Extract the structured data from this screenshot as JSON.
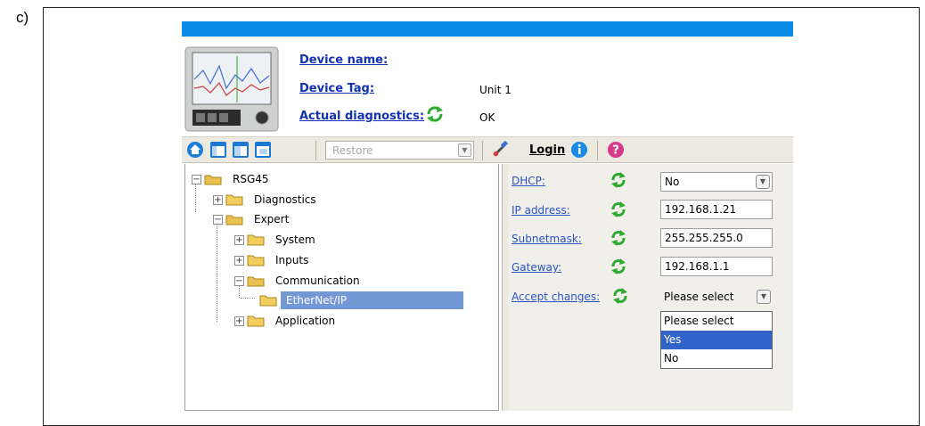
{
  "figure_label": "c)",
  "header": {
    "device_name_label": "Device name:",
    "device_name_value": "",
    "device_tag_label": "Device Tag:",
    "device_tag_value": "Unit 1",
    "diagnostics_label": "Actual diagnostics:",
    "diagnostics_value": "OK"
  },
  "toolbar": {
    "restore_label": "Restore",
    "login_label": "Login"
  },
  "tree": {
    "root": "RSG45",
    "diagnostics": "Diagnostics",
    "expert": "Expert",
    "system": "System",
    "inputs": "Inputs",
    "communication": "Communication",
    "ethernet_ip": "EtherNet/IP",
    "application": "Application"
  },
  "params": {
    "dhcp_label": "DHCP:",
    "dhcp_value": "No",
    "ip_label": "IP address:",
    "ip_value": "192.168.1.21",
    "subnet_label": "Subnetmask:",
    "subnet_value": "255.255.255.0",
    "gateway_label": "Gateway:",
    "gateway_value": "192.168.1.1",
    "accept_label": "Accept changes:",
    "accept_value": "Please select",
    "accept_options": [
      "Please select",
      "Yes",
      "No"
    ],
    "accept_highlighted": "Yes"
  },
  "colors": {
    "title_bar": "#0a8ce6",
    "link": "#2c53c4",
    "selection": "#7398d6",
    "refresh_icon": "#2eaa2e"
  }
}
